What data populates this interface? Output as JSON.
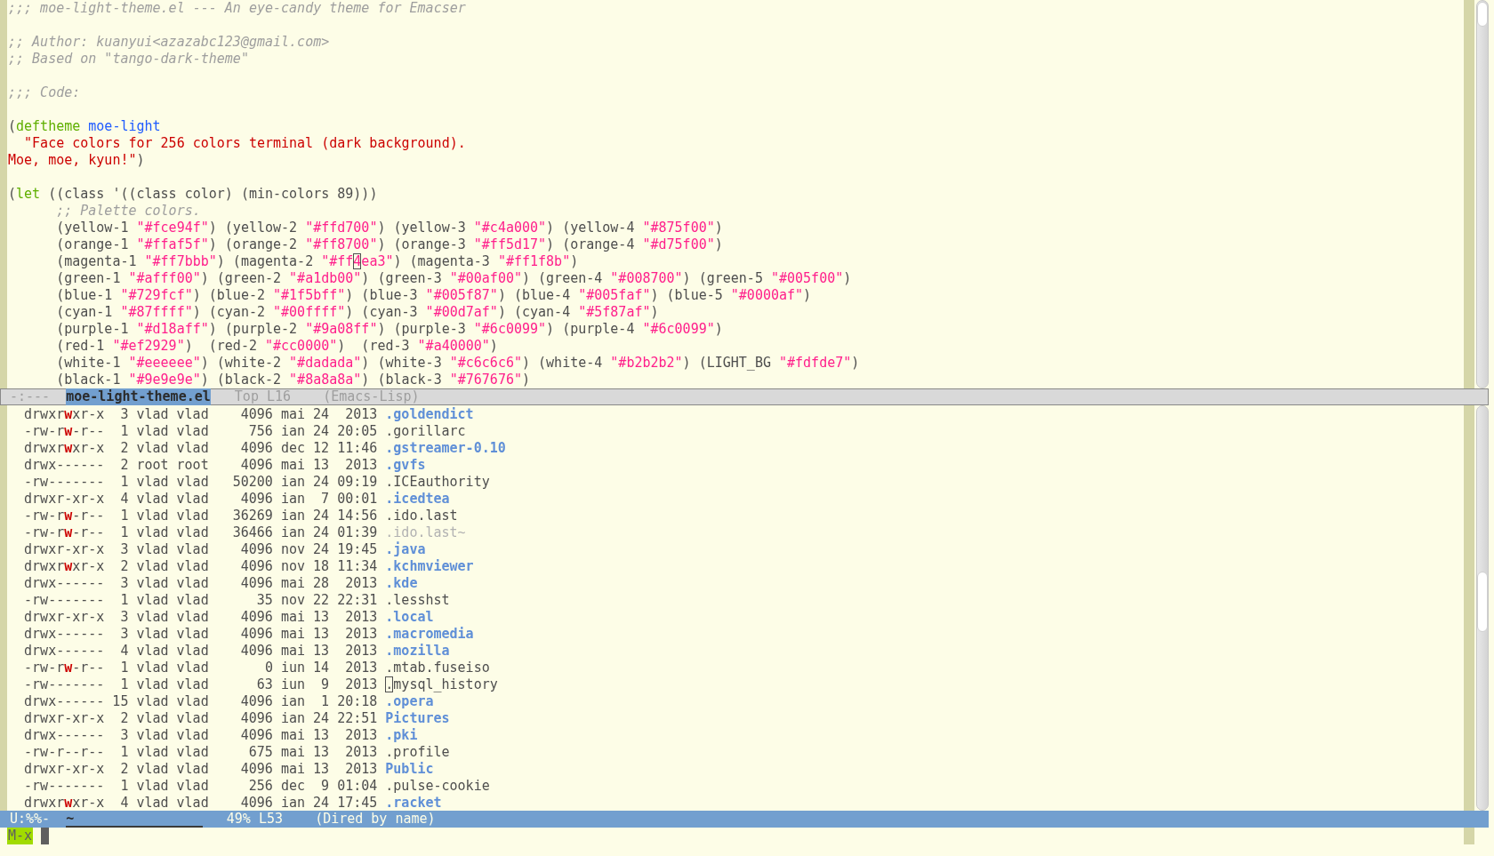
{
  "code_lines": [
    {
      "kind": "flush",
      "tokens": [
        {
          "kind": "comment",
          "text": ";;; moe-light-theme.el --- An eye-candy theme for Emacser"
        }
      ]
    },
    {
      "kind": "blank"
    },
    {
      "kind": "flush",
      "tokens": [
        {
          "kind": "comment",
          "text": ";; Author: kuanyui<azazabc123@gmail.com>"
        }
      ]
    },
    {
      "kind": "flush",
      "tokens": [
        {
          "kind": "comment",
          "text": ";; Based on \"tango-dark-theme\""
        }
      ]
    },
    {
      "kind": "blank"
    },
    {
      "kind": "flush",
      "tokens": [
        {
          "kind": "comment",
          "text": ";;; Code:"
        }
      ]
    },
    {
      "kind": "blank"
    },
    {
      "kind": "flush",
      "tokens": [
        {
          "kind": "plain",
          "text": "("
        },
        {
          "kind": "keyword",
          "text": "deftheme "
        },
        {
          "kind": "name",
          "text": "moe-light"
        }
      ]
    },
    {
      "kind": "indented",
      "tokens": [
        {
          "kind": "string",
          "text": "\"Face colors for 256 colors terminal (dark background)."
        }
      ]
    },
    {
      "kind": "flush",
      "tokens": [
        {
          "kind": "string",
          "text": "Moe, moe, kyun!\""
        },
        {
          "kind": "plain",
          "text": ")"
        }
      ]
    },
    {
      "kind": "blank"
    },
    {
      "kind": "flush",
      "tokens": [
        {
          "kind": "plain",
          "text": "("
        },
        {
          "kind": "keyword",
          "text": "let"
        },
        {
          "kind": "plain",
          "text": " ((class '((class color) (min-colors 89)))"
        }
      ]
    },
    {
      "kind": "nested",
      "tokens": [
        {
          "kind": "comment",
          "text": ";; Palette colors."
        }
      ]
    },
    {
      "kind": "nested",
      "tokens": [
        {
          "kind": "plain",
          "text": "(yellow-1 "
        },
        {
          "kind": "hex",
          "text": "\"#fce94f\""
        },
        {
          "kind": "plain",
          "text": ") (yellow-2 "
        },
        {
          "kind": "hex",
          "text": "\"#ffd700\""
        },
        {
          "kind": "plain",
          "text": ") (yellow-3 "
        },
        {
          "kind": "hex",
          "text": "\"#c4a000\""
        },
        {
          "kind": "plain",
          "text": ") (yellow-4 "
        },
        {
          "kind": "hex",
          "text": "\"#875f00\""
        },
        {
          "kind": "plain",
          "text": ")"
        }
      ]
    },
    {
      "kind": "nested",
      "tokens": [
        {
          "kind": "plain",
          "text": "(orange-1 "
        },
        {
          "kind": "hex",
          "text": "\"#ffaf5f\""
        },
        {
          "kind": "plain",
          "text": ") (orange-2 "
        },
        {
          "kind": "hex",
          "text": "\"#ff8700\""
        },
        {
          "kind": "plain",
          "text": ") (orange-3 "
        },
        {
          "kind": "hex",
          "text": "\"#ff5d17\""
        },
        {
          "kind": "plain",
          "text": ") (orange-4 "
        },
        {
          "kind": "hex",
          "text": "\"#d75f00\""
        },
        {
          "kind": "plain",
          "text": ")"
        }
      ]
    },
    {
      "kind": "nested",
      "tokens": [
        {
          "kind": "plain",
          "text": "(magenta-1 "
        },
        {
          "kind": "hex",
          "text": "\"#ff7bbb\""
        },
        {
          "kind": "plain",
          "text": ") (magenta-2 "
        },
        {
          "kind": "hex",
          "text": "\"#ff"
        },
        {
          "kind": "cursor",
          "text": "4"
        },
        {
          "kind": "hex",
          "text": "ea3\""
        },
        {
          "kind": "plain",
          "text": ") (magenta-3 "
        },
        {
          "kind": "hex",
          "text": "\"#ff1f8b\""
        },
        {
          "kind": "plain",
          "text": ")"
        }
      ]
    },
    {
      "kind": "nested",
      "tokens": [
        {
          "kind": "plain",
          "text": "(green-1 "
        },
        {
          "kind": "hex",
          "text": "\"#afff00\""
        },
        {
          "kind": "plain",
          "text": ") (green-2 "
        },
        {
          "kind": "hex",
          "text": "\"#a1db00\""
        },
        {
          "kind": "plain",
          "text": ") (green-3 "
        },
        {
          "kind": "hex",
          "text": "\"#00af00\""
        },
        {
          "kind": "plain",
          "text": ") (green-4 "
        },
        {
          "kind": "hex",
          "text": "\"#008700\""
        },
        {
          "kind": "plain",
          "text": ") (green-5 "
        },
        {
          "kind": "hex",
          "text": "\"#005f00\""
        },
        {
          "kind": "plain",
          "text": ")"
        }
      ]
    },
    {
      "kind": "nested",
      "tokens": [
        {
          "kind": "plain",
          "text": "(blue-1 "
        },
        {
          "kind": "hex",
          "text": "\"#729fcf\""
        },
        {
          "kind": "plain",
          "text": ") (blue-2 "
        },
        {
          "kind": "hex",
          "text": "\"#1f5bff\""
        },
        {
          "kind": "plain",
          "text": ") (blue-3 "
        },
        {
          "kind": "hex",
          "text": "\"#005f87\""
        },
        {
          "kind": "plain",
          "text": ") (blue-4 "
        },
        {
          "kind": "hex",
          "text": "\"#005faf\""
        },
        {
          "kind": "plain",
          "text": ") (blue-5 "
        },
        {
          "kind": "hex",
          "text": "\"#0000af\""
        },
        {
          "kind": "plain",
          "text": ")"
        }
      ]
    },
    {
      "kind": "nested",
      "tokens": [
        {
          "kind": "plain",
          "text": "(cyan-1 "
        },
        {
          "kind": "hex",
          "text": "\"#87ffff\""
        },
        {
          "kind": "plain",
          "text": ") (cyan-2 "
        },
        {
          "kind": "hex",
          "text": "\"#00ffff\""
        },
        {
          "kind": "plain",
          "text": ") (cyan-3 "
        },
        {
          "kind": "hex",
          "text": "\"#00d7af\""
        },
        {
          "kind": "plain",
          "text": ") (cyan-4 "
        },
        {
          "kind": "hex",
          "text": "\"#5f87af\""
        },
        {
          "kind": "plain",
          "text": ")"
        }
      ]
    },
    {
      "kind": "nested",
      "tokens": [
        {
          "kind": "plain",
          "text": "(purple-1 "
        },
        {
          "kind": "hex",
          "text": "\"#d18aff\""
        },
        {
          "kind": "plain",
          "text": ") (purple-2 "
        },
        {
          "kind": "hex",
          "text": "\"#9a08ff\""
        },
        {
          "kind": "plain",
          "text": ") (purple-3 "
        },
        {
          "kind": "hex",
          "text": "\"#6c0099\""
        },
        {
          "kind": "plain",
          "text": ") (purple-4 "
        },
        {
          "kind": "hex",
          "text": "\"#6c0099\""
        },
        {
          "kind": "plain",
          "text": ")"
        }
      ]
    },
    {
      "kind": "nested",
      "tokens": [
        {
          "kind": "plain",
          "text": "(red-1 "
        },
        {
          "kind": "hex",
          "text": "\"#ef2929\""
        },
        {
          "kind": "plain",
          "text": ")  (red-2 "
        },
        {
          "kind": "hex",
          "text": "\"#cc0000\""
        },
        {
          "kind": "plain",
          "text": ")  (red-3 "
        },
        {
          "kind": "hex",
          "text": "\"#a40000\""
        },
        {
          "kind": "plain",
          "text": ")"
        }
      ]
    },
    {
      "kind": "nested",
      "tokens": [
        {
          "kind": "plain",
          "text": "(white-1 "
        },
        {
          "kind": "hex",
          "text": "\"#eeeeee\""
        },
        {
          "kind": "plain",
          "text": ") (white-2 "
        },
        {
          "kind": "hex",
          "text": "\"#dadada\""
        },
        {
          "kind": "plain",
          "text": ") (white-3 "
        },
        {
          "kind": "hex",
          "text": "\"#c6c6c6\""
        },
        {
          "kind": "plain",
          "text": ") (white-4 "
        },
        {
          "kind": "hex",
          "text": "\"#b2b2b2\""
        },
        {
          "kind": "plain",
          "text": ") (LIGHT_BG "
        },
        {
          "kind": "hex",
          "text": "\"#fdfde7\""
        },
        {
          "kind": "plain",
          "text": ")"
        }
      ]
    },
    {
      "kind": "nested",
      "tokens": [
        {
          "kind": "plain",
          "text": "(black-1 "
        },
        {
          "kind": "hex",
          "text": "\"#9e9e9e\""
        },
        {
          "kind": "plain",
          "text": ") (black-2 "
        },
        {
          "kind": "hex",
          "text": "\"#8a8a8a\""
        },
        {
          "kind": "plain",
          "text": ") (black-3 "
        },
        {
          "kind": "hex",
          "text": "\"#767676\""
        },
        {
          "kind": "plain",
          "text": ")"
        }
      ]
    }
  ],
  "top_mode_line": {
    "active": false,
    "state": "-:---",
    "buffer": "moe-light-theme.el",
    "position": "Top L16",
    "mode": "(Emacs-Lisp)"
  },
  "dired_rows": [
    {
      "perms": "drwxrwxr-x",
      "group_writable": true,
      "links": "3",
      "owner": "vlad",
      "group": "vlad",
      "size": "4096",
      "date": "mai 24  2013",
      "name": ".goldendict",
      "kind": "dir",
      "cursor": false
    },
    {
      "perms": "-rw-rw-r--",
      "group_writable": true,
      "links": "1",
      "owner": "vlad",
      "group": "vlad",
      "size": "756",
      "date": "ian 24 20:05",
      "name": ".gorillarc",
      "kind": "file",
      "cursor": false
    },
    {
      "perms": "drwxrwxr-x",
      "group_writable": true,
      "links": "2",
      "owner": "vlad",
      "group": "vlad",
      "size": "4096",
      "date": "dec 12 11:46",
      "name": ".gstreamer-0.10",
      "kind": "dir",
      "cursor": false
    },
    {
      "perms": "drwx------",
      "group_writable": false,
      "links": "2",
      "owner": "root",
      "group": "root",
      "size": "4096",
      "date": "mai 13  2013",
      "name": ".gvfs",
      "kind": "dir",
      "cursor": false
    },
    {
      "perms": "-rw-------",
      "group_writable": false,
      "links": "1",
      "owner": "vlad",
      "group": "vlad",
      "size": "50200",
      "date": "ian 24 09:19",
      "name": ".ICEauthority",
      "kind": "file",
      "cursor": false
    },
    {
      "perms": "drwxr-xr-x",
      "group_writable": false,
      "links": "4",
      "owner": "vlad",
      "group": "vlad",
      "size": "4096",
      "date": "ian  7 00:01",
      "name": ".icedtea",
      "kind": "dir",
      "cursor": false
    },
    {
      "perms": "-rw-rw-r--",
      "group_writable": true,
      "links": "1",
      "owner": "vlad",
      "group": "vlad",
      "size": "36269",
      "date": "ian 24 14:56",
      "name": ".ido.last",
      "kind": "file",
      "cursor": false
    },
    {
      "perms": "-rw-rw-r--",
      "group_writable": true,
      "links": "1",
      "owner": "vlad",
      "group": "vlad",
      "size": "36466",
      "date": "ian 24 01:39",
      "name": ".ido.last~",
      "kind": "backup",
      "cursor": false
    },
    {
      "perms": "drwxr-xr-x",
      "group_writable": false,
      "links": "3",
      "owner": "vlad",
      "group": "vlad",
      "size": "4096",
      "date": "nov 24 19:45",
      "name": ".java",
      "kind": "dir",
      "cursor": false
    },
    {
      "perms": "drwxrwxr-x",
      "group_writable": true,
      "links": "2",
      "owner": "vlad",
      "group": "vlad",
      "size": "4096",
      "date": "nov 18 11:34",
      "name": ".kchmviewer",
      "kind": "dir",
      "cursor": false
    },
    {
      "perms": "drwx------",
      "group_writable": false,
      "links": "3",
      "owner": "vlad",
      "group": "vlad",
      "size": "4096",
      "date": "mai 28  2013",
      "name": ".kde",
      "kind": "dir",
      "cursor": false
    },
    {
      "perms": "-rw-------",
      "group_writable": false,
      "links": "1",
      "owner": "vlad",
      "group": "vlad",
      "size": "35",
      "date": "nov 22 22:31",
      "name": ".lesshst",
      "kind": "file",
      "cursor": false
    },
    {
      "perms": "drwxr-xr-x",
      "group_writable": false,
      "links": "3",
      "owner": "vlad",
      "group": "vlad",
      "size": "4096",
      "date": "mai 13  2013",
      "name": ".local",
      "kind": "dir",
      "cursor": false
    },
    {
      "perms": "drwx------",
      "group_writable": false,
      "links": "3",
      "owner": "vlad",
      "group": "vlad",
      "size": "4096",
      "date": "mai 13  2013",
      "name": ".macromedia",
      "kind": "dir",
      "cursor": false
    },
    {
      "perms": "drwx------",
      "group_writable": false,
      "links": "4",
      "owner": "vlad",
      "group": "vlad",
      "size": "4096",
      "date": "mai 13  2013",
      "name": ".mozilla",
      "kind": "dir",
      "cursor": false
    },
    {
      "perms": "-rw-rw-r--",
      "group_writable": true,
      "links": "1",
      "owner": "vlad",
      "group": "vlad",
      "size": "0",
      "date": "iun 14  2013",
      "name": ".mtab.fuseiso",
      "kind": "file",
      "cursor": false
    },
    {
      "perms": "-rw-------",
      "group_writable": false,
      "links": "1",
      "owner": "vlad",
      "group": "vlad",
      "size": "63",
      "date": "iun  9  2013",
      "name": ".mysql_history",
      "kind": "file",
      "cursor": true
    },
    {
      "perms": "drwx------",
      "group_writable": false,
      "links": "15",
      "owner": "vlad",
      "group": "vlad",
      "size": "4096",
      "date": "ian  1 20:18",
      "name": ".opera",
      "kind": "dir",
      "cursor": false
    },
    {
      "perms": "drwxr-xr-x",
      "group_writable": false,
      "links": "2",
      "owner": "vlad",
      "group": "vlad",
      "size": "4096",
      "date": "ian 24 22:51",
      "name": "Pictures",
      "kind": "dir",
      "cursor": false
    },
    {
      "perms": "drwx------",
      "group_writable": false,
      "links": "3",
      "owner": "vlad",
      "group": "vlad",
      "size": "4096",
      "date": "mai 13  2013",
      "name": ".pki",
      "kind": "dir",
      "cursor": false
    },
    {
      "perms": "-rw-r--r--",
      "group_writable": false,
      "links": "1",
      "owner": "vlad",
      "group": "vlad",
      "size": "675",
      "date": "mai 13  2013",
      "name": ".profile",
      "kind": "file",
      "cursor": false
    },
    {
      "perms": "drwxr-xr-x",
      "group_writable": false,
      "links": "2",
      "owner": "vlad",
      "group": "vlad",
      "size": "4096",
      "date": "mai 13  2013",
      "name": "Public",
      "kind": "dir",
      "cursor": false
    },
    {
      "perms": "-rw-------",
      "group_writable": false,
      "links": "1",
      "owner": "vlad",
      "group": "vlad",
      "size": "256",
      "date": "dec  9 01:04",
      "name": ".pulse-cookie",
      "kind": "file",
      "cursor": false
    },
    {
      "perms": "drwxrwxr-x",
      "group_writable": true,
      "links": "4",
      "owner": "vlad",
      "group": "vlad",
      "size": "4096",
      "date": "ian 24 17:45",
      "name": ".racket",
      "kind": "dir",
      "cursor": false
    }
  ],
  "bottom_mode_line": {
    "active": true,
    "state": "U:%%-",
    "buffer": "~",
    "position": "49% L53",
    "mode": "(Dired by name)"
  },
  "minibuffer": {
    "prompt": "M-x"
  }
}
